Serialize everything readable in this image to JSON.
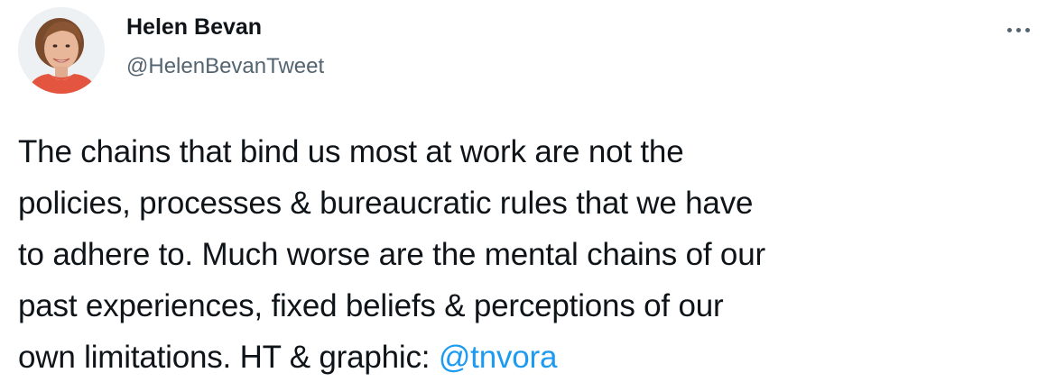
{
  "author": {
    "display_name": "Helen Bevan",
    "handle": "@HelenBevanTweet"
  },
  "more_icon": "more-horizontal-icon",
  "tweet": {
    "lines": [
      "The chains that bind us most at work are not the",
      "policies, processes & bureaucratic rules that we have",
      "to adhere to. Much worse are the mental chains of our",
      "past experiences, fixed beliefs & perceptions of our"
    ],
    "last_line_text": "own limitations. HT & graphic: ",
    "mention": "@tnvora"
  },
  "colors": {
    "text": "#0f1419",
    "secondary": "#536471",
    "link": "#1d9bf0",
    "background": "#ffffff"
  }
}
